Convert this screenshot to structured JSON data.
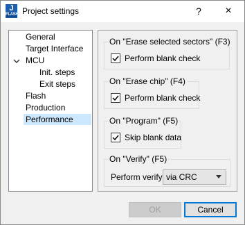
{
  "window": {
    "title": "Project settings",
    "icon_letter": "J",
    "icon_sub": "FLASH",
    "help_label": "?",
    "close_label": "×"
  },
  "tree": {
    "items": [
      {
        "label": "General",
        "selected": false
      },
      {
        "label": "Target Interface",
        "selected": false
      },
      {
        "label": "MCU",
        "selected": false,
        "expanded": true
      },
      {
        "label": "Init. steps",
        "selected": false
      },
      {
        "label": "Exit steps",
        "selected": false
      },
      {
        "label": "Flash",
        "selected": false
      },
      {
        "label": "Production",
        "selected": false
      },
      {
        "label": "Performance",
        "selected": true
      }
    ]
  },
  "groups": {
    "erase_sectors": {
      "legend": "On \"Erase selected sectors\" (F3)",
      "checkbox_label": "Perform blank check",
      "checked": true
    },
    "erase_chip": {
      "legend": "On \"Erase chip\" (F4)",
      "checkbox_label": "Perform blank check",
      "checked": true
    },
    "program": {
      "legend": "On \"Program\" (F5)",
      "checkbox_label": "Skip blank data",
      "checked": true
    },
    "verify": {
      "legend": "On \"Verify\" (F5)",
      "label": "Perform verify",
      "selected": "via CRC"
    }
  },
  "buttons": {
    "ok": "OK",
    "cancel": "Cancel"
  },
  "colors": {
    "selection": "#cce8ff",
    "icon_bg": "#1b5fae",
    "focus": "#0078d7"
  }
}
